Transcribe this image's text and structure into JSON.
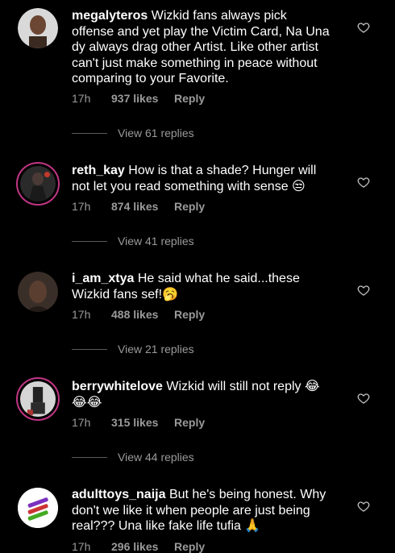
{
  "comments": [
    {
      "username": "megalyteros",
      "text": "Wizkid fans always pick offense and yet play the Victim Card, Na Una dy always drag other Artist. Like other artist can't just make something in peace without comparing to your Favorite.",
      "time": "17h",
      "likes": "937 likes",
      "reply": "Reply",
      "view_replies": "View 61 replies",
      "avatar_icon": "avatar-man-photo"
    },
    {
      "username": "reth_kay",
      "text": "How is that a shade? Hunger will not let you read something with sense 😒",
      "time": "17h",
      "likes": "874 likes",
      "reply": "Reply",
      "view_replies": "View 41 replies",
      "avatar_icon": "avatar-woman-photo-story-ring"
    },
    {
      "username": "i_am_xtya",
      "text": "He said what he said...these Wizkid fans sef!🥱",
      "time": "17h",
      "likes": "488 likes",
      "reply": "Reply",
      "view_replies": "View 21 replies",
      "avatar_icon": "avatar-woman-dark-photo"
    },
    {
      "username": "berrywhitelove",
      "text": "Wizkid will still not reply 😂😂😂",
      "time": "17h",
      "likes": "315 likes",
      "reply": "Reply",
      "view_replies": "View 44 replies",
      "avatar_icon": "avatar-person-photo-story-ring"
    },
    {
      "username": "adulttoys_naija",
      "text": "But he's being honest. Why don't we like it when people are just being real??? Una like fake life tufia 🙏",
      "time": "17h",
      "likes": "296 likes",
      "reply": "Reply",
      "avatar_icon": "avatar-products-logo"
    }
  ]
}
